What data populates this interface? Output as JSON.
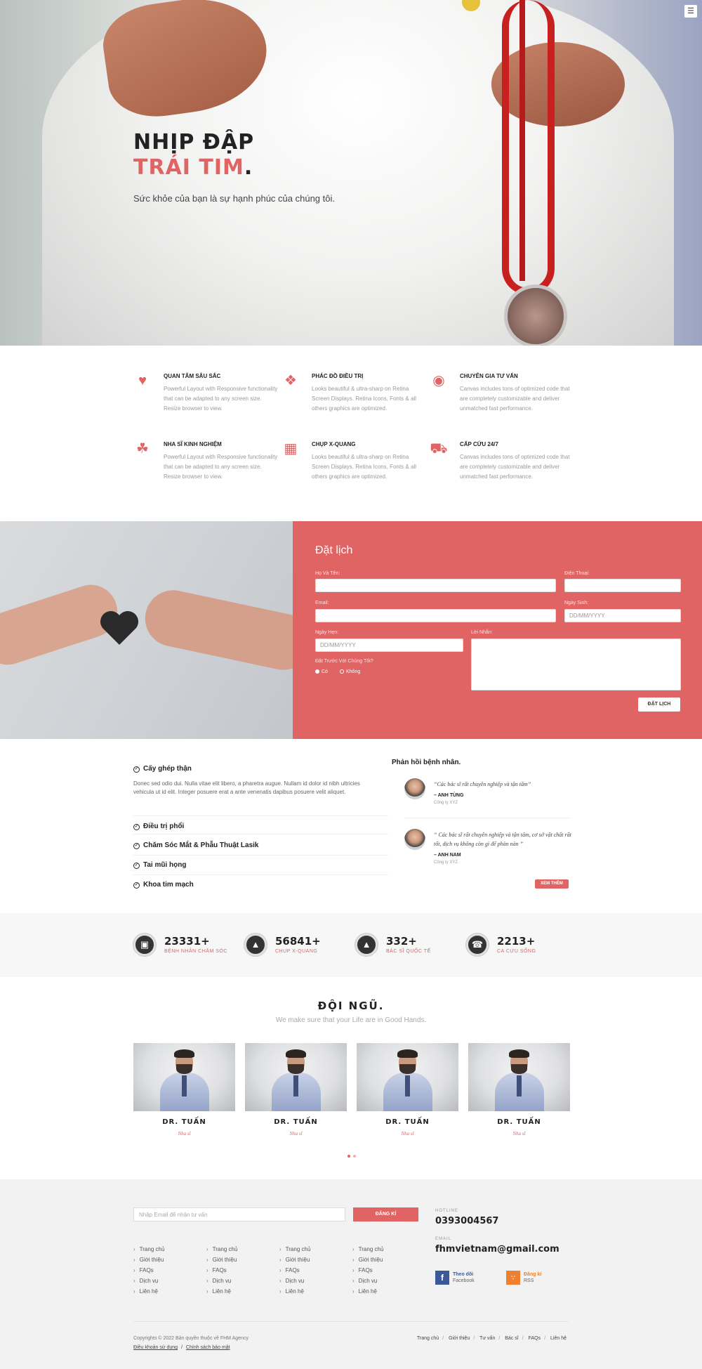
{
  "hero": {
    "title_line1": "NHỊP ĐẬP",
    "title_line2": "TRÁI TIM",
    "title_dot": ".",
    "subtitle": "Sức khỏe của bạn là sự hạnh phúc của chúng tôi.",
    "menu_icon": "menu-icon"
  },
  "features": [
    {
      "icon": "heart-pulse-icon",
      "title": "QUAN TÂM SÂU SẮC",
      "desc": "Powerful Layout with Responsive functionality that can be adapted to any screen size. Resize browser to view."
    },
    {
      "icon": "hands-icon",
      "title": "PHÁC ĐỒ ĐIỀU TRỊ",
      "desc": "Looks beautiful & ultra-sharp on Retina Screen Displays. Retina Icons, Fonts & all others graphics are optimized."
    },
    {
      "icon": "head-brain-icon",
      "title": "CHUYÊN GIA TƯ VẤN",
      "desc": "Canvas includes tons of optimized code that are completely customizable and deliver unmatched fast performance."
    },
    {
      "icon": "tooth-icon",
      "title": "NHA SĨ KINH NGHIỆM",
      "desc": "Powerful Layout with Responsive functionality that can be adapted to any screen size. Resize browser to view."
    },
    {
      "icon": "xray-icon",
      "title": "CHỤP X-QUANG",
      "desc": "Looks beautiful & ultra-sharp on Retina Screen Displays. Retina Icons, Fonts & all others graphics are optimized."
    },
    {
      "icon": "ambulance-icon",
      "title": "CẤP CỨU 24/7",
      "desc": "Canvas includes tons of optimized code that are completely customizable and deliver unmatched fast performance."
    }
  ],
  "booking": {
    "title": "Đặt lịch",
    "name_label": "Họ Và Tên:",
    "phone_label": "Điện Thoại:",
    "email_label": "Email:",
    "dob_label": "Ngày Sinh:",
    "dob_placeholder": "DD/MM/YYYY",
    "appt_label": "Ngày Hẹn:",
    "appt_placeholder": "DD/MM/YYYY",
    "message_label": "Lời Nhắn:",
    "prev_label": "Đặt Trước Với Chúng Tôi?",
    "yes": "Có",
    "no": "Không",
    "submit": "ĐẶT LỊCH"
  },
  "services": [
    {
      "title": "Cấy ghép thận",
      "body": "Donec sed odio dui. Nulla vitae elit libero, a pharetra augue. Nullam id dolor id nibh ultricies vehicula ut id elit. Integer posuere erat a ante venenatis dapibus posuere velit aliquet."
    },
    {
      "title": "Điều trị phổi"
    },
    {
      "title": "Chăm Sóc Mắt & Phẫu Thuật Lasik"
    },
    {
      "title": "Tai mũi họng"
    },
    {
      "title": "Khoa tim mạch"
    }
  ],
  "testimonials": {
    "title": "Phản hồi bệnh nhân.",
    "items": [
      {
        "quote": "“Các bác sĩ rất chuyên nghiệp và tận tâm”",
        "name": "– ANH TÙNG",
        "company": "Công ty XYZ"
      },
      {
        "quote": "“ Các bác sĩ rất chuyên nghiệp và tận tâm, cơ sở vật chất rất tốt, dịch vụ không còn gì để phàn nàn ”",
        "name": "– ANH NAM",
        "company": "Công ty XYZ"
      }
    ],
    "more": "XEM THÊM"
  },
  "stats": [
    {
      "icon": "monitor-icon",
      "number": "23331+",
      "label": "BỆNH NHÂN CHĂM SÓC"
    },
    {
      "icon": "drop-icon",
      "number": "56841+",
      "label": "CHỤP X-QUANG"
    },
    {
      "icon": "drop-icon",
      "number": "332+",
      "label": "BÁC SĨ QUỐC TẾ"
    },
    {
      "icon": "emergency-icon",
      "number": "2213+",
      "label": "CA CỨU SỐNG"
    }
  ],
  "team": {
    "title": "ĐỘI NGŨ.",
    "subtitle": "We make sure that your Life are in Good Hands.",
    "members": [
      {
        "name": "DR. TUẤN",
        "role": "Nha sĩ"
      },
      {
        "name": "DR. TUẤN",
        "role": "Nha sĩ"
      },
      {
        "name": "DR. TUẤN",
        "role": "Nha sĩ"
      },
      {
        "name": "DR. TUẤN",
        "role": "Nha sĩ"
      }
    ]
  },
  "footer": {
    "email_placeholder": "Nhập Email để nhận tư vấn",
    "subscribe": "ĐĂNG KÍ",
    "link_columns": [
      [
        "Trang chủ",
        "Giới thiệu",
        "FAQs",
        "Dịch vụ",
        "Liên hệ"
      ],
      [
        "Trang chủ",
        "Giới thiệu",
        "FAQs",
        "Dịch vụ",
        "Liên hệ"
      ],
      [
        "Trang chủ",
        "Giới thiệu",
        "FAQs",
        "Dịch vụ",
        "Liên hệ"
      ],
      [
        "Trang chủ",
        "Giới thiệu",
        "FAQs",
        "Dịch vụ",
        "Liên hệ"
      ]
    ],
    "hotline_label": "HOTLINE",
    "hotline": "0393004567",
    "email_label": "EMAIL",
    "email": "fhmvietnam@gmail.com",
    "facebook_title": "Theo dõi",
    "facebook_sub": "Facebook",
    "rss_title": "Đăng kí",
    "rss_sub": "RSS",
    "copyright": "Copyrights © 2022 Bản quyền thuộc về FHM Agency",
    "terms": "Điều khoản sử dụng",
    "privacy": "Chính sách bảo mật",
    "bottom_nav": [
      "Trang chủ",
      "Giới thiệu",
      "Tư vấn",
      "Bác sĩ",
      "FAQs",
      "Liên hệ"
    ]
  },
  "colors": {
    "accent": "#e06464",
    "dark": "#222222",
    "footer_bg": "#f2f2f2"
  }
}
